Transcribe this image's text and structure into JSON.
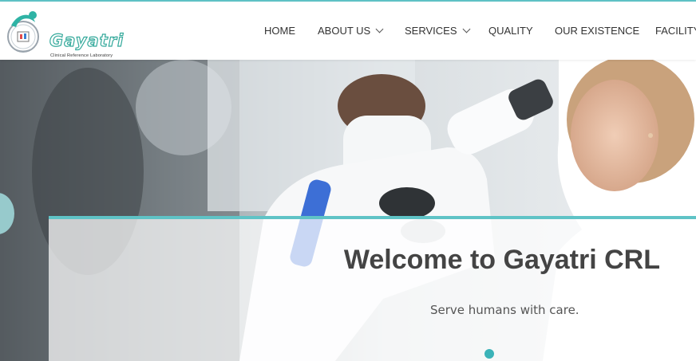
{
  "brand": {
    "name": "Gayatri",
    "subtitle": "Clinical Reference Laboratory"
  },
  "nav": {
    "items": [
      {
        "label": "HOME",
        "dropdown": false
      },
      {
        "label": "ABOUT US",
        "dropdown": true
      },
      {
        "label": "SERVICES",
        "dropdown": true
      },
      {
        "label": "QUALITY",
        "dropdown": false
      },
      {
        "label": "OUR EXISTENCE",
        "dropdown": false
      },
      {
        "label": "FACILITY",
        "dropdown": false
      }
    ]
  },
  "hero": {
    "title": "Welcome to Gayatri CRL",
    "subtitle": "Serve humans with care.",
    "slide_count": 1,
    "active_slide": 1
  },
  "colors": {
    "accent": "#5fc3c6",
    "dot": "#3bb3b8",
    "nav_text": "#333333",
    "title_text": "#444444"
  },
  "icons": {
    "logo": "lab-logo-icon",
    "dropdown": "chevron-down-icon"
  }
}
